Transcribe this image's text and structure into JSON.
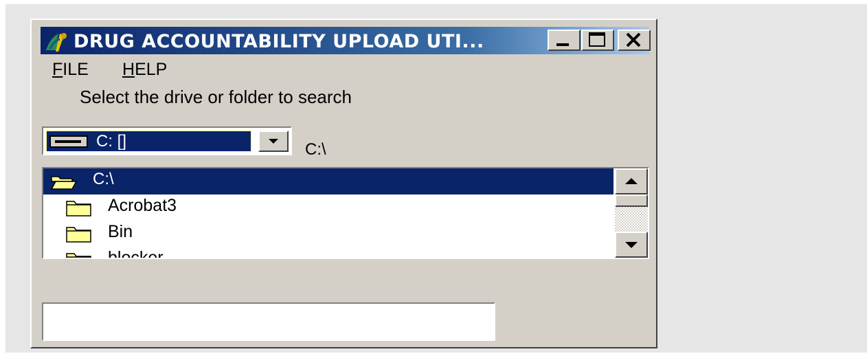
{
  "window": {
    "title": "DRUG ACCOUNTABILITY UPLOAD UTI..."
  },
  "menu": {
    "file": {
      "accel": "F",
      "rest": "ILE"
    },
    "help": {
      "accel": "H",
      "rest": "ELP"
    }
  },
  "prompt": "Select the drive or folder to search",
  "drive": {
    "selected": "C: []",
    "current_path": "C:\\"
  },
  "folders": {
    "root": "C:\\",
    "items": [
      "Acrobat3",
      "Bin",
      "blocker"
    ]
  },
  "status_field": {
    "value": ""
  },
  "colors": {
    "face": "#d4d0c8",
    "selection": "#0a246a",
    "title_gradient_start": "#0a246a",
    "title_gradient_end": "#a6caf0",
    "folder": "#ffff99"
  }
}
